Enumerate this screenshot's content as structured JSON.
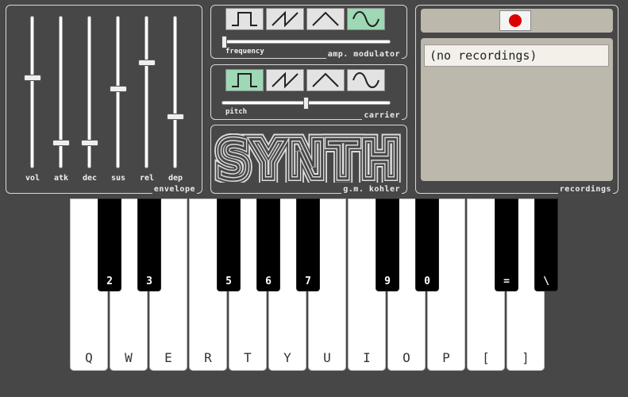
{
  "envelope": {
    "label": "envelope",
    "sliders": [
      {
        "label": "vol",
        "value": 0.6
      },
      {
        "label": "atk",
        "value": 0.15
      },
      {
        "label": "dec",
        "value": 0.15
      },
      {
        "label": "sus",
        "value": 0.52
      },
      {
        "label": "rel",
        "value": 0.7
      },
      {
        "label": "dep",
        "value": 0.33
      }
    ]
  },
  "amp_modulator": {
    "label": "amp. modulator",
    "waves": [
      "square-wave-icon",
      "sawtooth-wave-icon",
      "triangle-wave-icon",
      "sine-wave-icon"
    ],
    "active_wave": 3,
    "slider_label": "frequency",
    "slider_value": 0.0
  },
  "carrier": {
    "label": "carrier",
    "waves": [
      "square-wave-icon",
      "sawtooth-wave-icon",
      "triangle-wave-icon",
      "sine-wave-icon"
    ],
    "active_wave": 0,
    "slider_label": "pitch",
    "slider_value": 0.5
  },
  "logo": {
    "text": "SYNTH",
    "credit": "g.m. kohler"
  },
  "recordings": {
    "label": "recordings",
    "record_icon": "record-icon",
    "items": [
      "(no recordings)"
    ]
  },
  "keyboard": {
    "white_keys": [
      "Q",
      "W",
      "E",
      "R",
      "T",
      "Y",
      "U",
      "I",
      "O",
      "P",
      "[",
      "]"
    ],
    "black_keys": [
      "2",
      "3",
      "5",
      "6",
      "7",
      "9",
      "0",
      "=",
      "\\"
    ]
  },
  "colors": {
    "background": "#474747",
    "active_wave": "#9ed8b4",
    "record_red": "#dd0000"
  }
}
